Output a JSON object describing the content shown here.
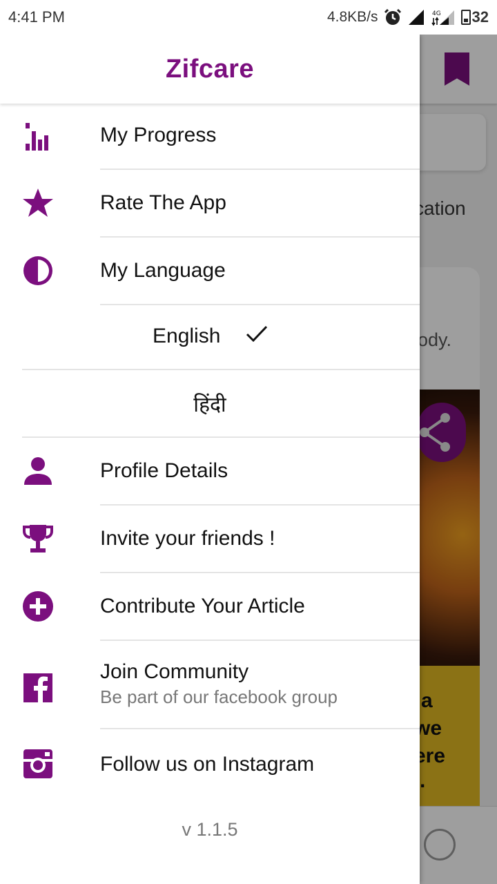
{
  "status_bar": {
    "time": "4:41 PM",
    "network_speed": "4.8KB/s",
    "network_type": "4G",
    "battery": "32"
  },
  "background": {
    "text_cation": "cation",
    "text_body": "body.",
    "yellow_lines": [
      "a",
      "we",
      "ere",
      "."
    ]
  },
  "drawer": {
    "title": "Zifcare",
    "items": [
      {
        "label": "My Progress",
        "icon": "bar-chart-icon"
      },
      {
        "label": "Rate The App",
        "icon": "star-icon"
      },
      {
        "label": "My Language",
        "icon": "contrast-icon"
      },
      {
        "label": "Profile Details",
        "icon": "person-icon"
      },
      {
        "label": "Invite your friends !",
        "icon": "trophy-icon"
      },
      {
        "label": "Contribute Your Article",
        "icon": "add-circle-icon"
      },
      {
        "label": "Join Community",
        "sublabel": "Be part of our facebook group",
        "icon": "facebook-icon"
      },
      {
        "label": "Follow us on Instagram",
        "icon": "instagram-icon"
      }
    ],
    "languages": [
      {
        "label": "English",
        "selected": true
      },
      {
        "label": "हिंदी",
        "selected": false
      }
    ],
    "version": "v 1.1.5"
  },
  "colors": {
    "accent": "#7b0f7e",
    "text": "#111111",
    "muted": "#777777"
  }
}
